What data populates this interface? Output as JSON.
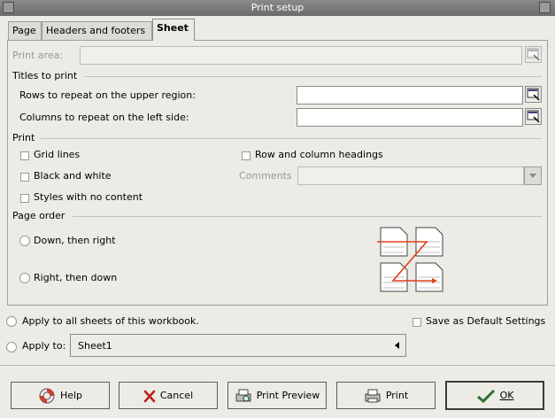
{
  "window": {
    "title": "Print setup"
  },
  "tabs": [
    {
      "label": "Page",
      "active": false
    },
    {
      "label": "Headers and footers",
      "active": false
    },
    {
      "label": "Sheet",
      "active": true
    }
  ],
  "sheet": {
    "print_area_label": "Print area:",
    "titles_section": "Titles to print",
    "rows_label": "Rows to repeat on the upper region:",
    "columns_label": "Columns to repeat on the left side:",
    "print_section": "Print",
    "grid_lines": "Grid lines",
    "black_and_white": "Black and white",
    "styles_no_content": "Styles with no content",
    "row_col_headings": "Row and column headings",
    "comments_label": "Comments",
    "page_order_section": "Page order",
    "down_then_right": "Down, then right",
    "right_then_down": "Right, then down"
  },
  "apply": {
    "all_sheets": "Apply to all sheets of this workbook.",
    "apply_to": "Apply to:",
    "sheet_value": "Sheet1",
    "save_default": "Save as Default Settings"
  },
  "buttons": {
    "help": "Help",
    "cancel": "Cancel",
    "preview": "Print Preview",
    "print": "Print",
    "ok": "OK"
  },
  "colors": {
    "arrow": "#e0401a",
    "background": "#ecebe6"
  }
}
